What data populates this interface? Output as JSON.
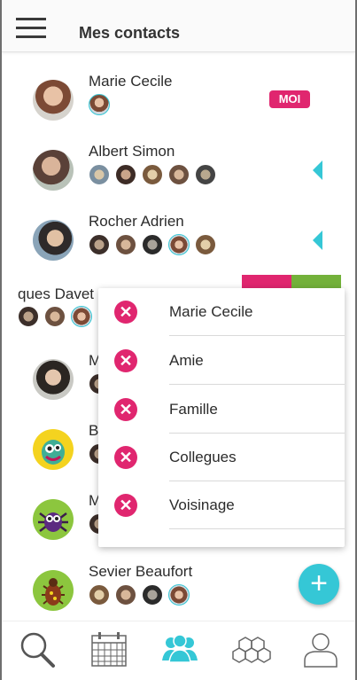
{
  "header": {
    "title": "Mes contacts"
  },
  "badges": {
    "me": "MOI"
  },
  "contacts": [
    {
      "name": "Marie Cecile"
    },
    {
      "name": "Albert Simon"
    },
    {
      "name": "Rocher Adrien"
    },
    {
      "name": "ques Davet"
    },
    {
      "name": "M"
    },
    {
      "name": "B"
    },
    {
      "name": "M"
    },
    {
      "name": "Sevier Beaufort"
    }
  ],
  "menu": {
    "items": [
      {
        "label": "Marie Cecile"
      },
      {
        "label": "Amie"
      },
      {
        "label": "Famille"
      },
      {
        "label": "Collegues"
      },
      {
        "label": "Voisinage"
      }
    ]
  },
  "colors": {
    "accent": "#35c7d6",
    "pink": "#e0266f",
    "green": "#73b13a"
  },
  "icons": {
    "fab": "plus-icon",
    "nav": [
      "search-icon",
      "calendar-icon",
      "contacts-icon",
      "hexagon-icon",
      "profile-icon"
    ]
  }
}
